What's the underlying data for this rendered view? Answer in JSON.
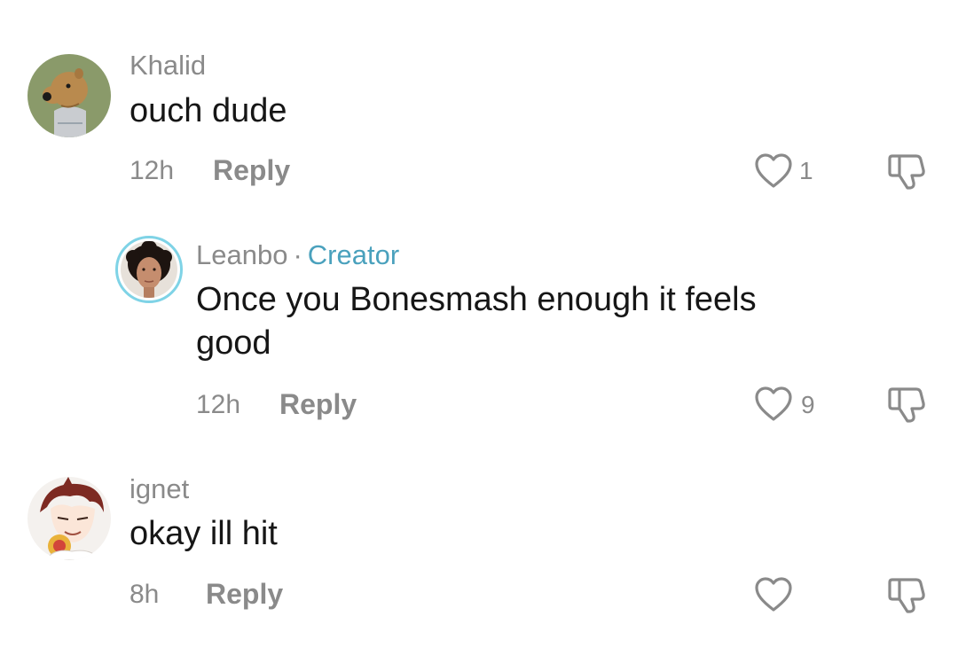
{
  "comments": [
    {
      "username": "Khalid",
      "text": "ouch dude",
      "time": "12h",
      "reply_label": "Reply",
      "likes": "1"
    },
    {
      "username": "Leanbo",
      "separator": "·",
      "badge": "Creator",
      "text_line1": "Once you Bonesmash enough it feels",
      "text_line2": "good",
      "time": "12h",
      "reply_label": "Reply",
      "likes": "9"
    },
    {
      "username": "ignet",
      "text": "okay ill hit",
      "time": "8h",
      "reply_label": "Reply",
      "likes": ""
    }
  ],
  "colors": {
    "creator_accent": "#4aa1bd",
    "meta_gray": "#8a8a8a",
    "text_black": "#161616"
  }
}
